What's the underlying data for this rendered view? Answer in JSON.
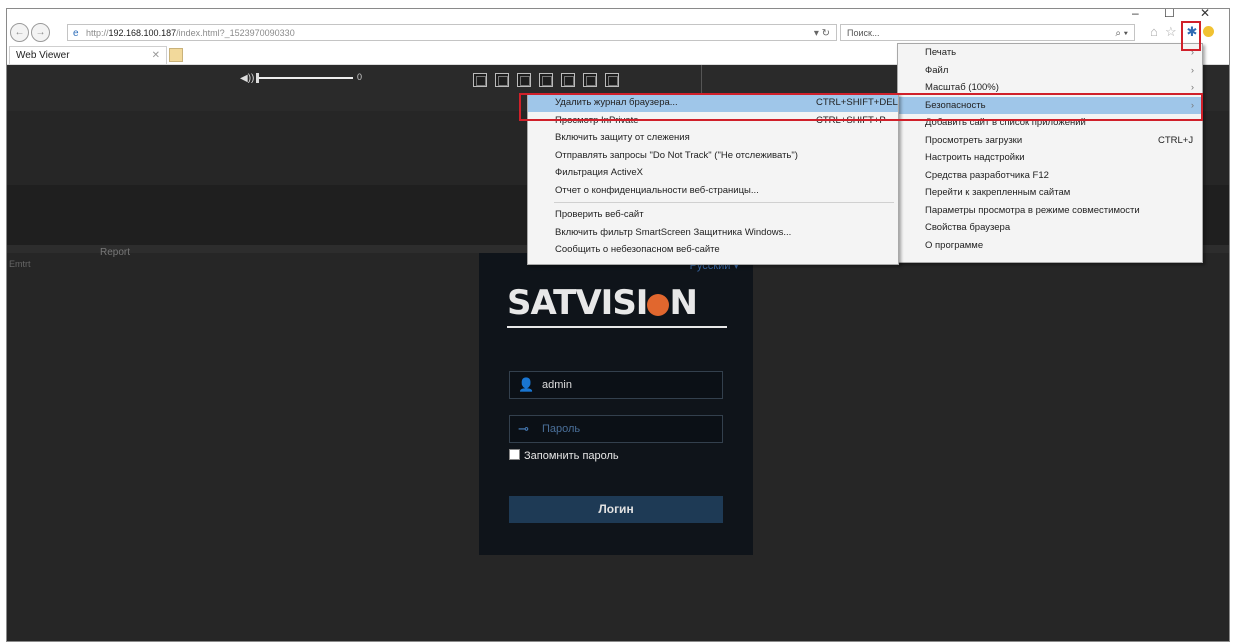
{
  "window": {
    "minimize_label": "–",
    "restore_label": "☐",
    "close_label": "✕"
  },
  "address_bar": {
    "url_prefix": "http://",
    "url_host": "192.168.100.187",
    "url_rest": "/index.html?_1523970090330",
    "refresh_label": "▾ ↻",
    "back_label": "←",
    "forward_label": "→"
  },
  "search": {
    "placeholder": "Поиск...",
    "icon_label": "⌕ ▾"
  },
  "tab": {
    "title": "Web Viewer",
    "close_label": "✕"
  },
  "player": {
    "volume_value": "0",
    "layout_buttons": 7
  },
  "labels": {
    "report": "Report",
    "emtr": "Emtrt"
  },
  "login": {
    "language": "Русский ▾",
    "logo_left": "SAT",
    "logo_mid": "VISI",
    "logo_right": "N",
    "username": "admin",
    "password_placeholder": "Пароль",
    "remember_label": "Запомнить пароль",
    "login_button": "Логин"
  },
  "tools_menu": {
    "items": [
      {
        "label": "Печать",
        "has_arrow": true
      },
      {
        "label": "Файл",
        "has_arrow": true
      },
      {
        "label": "Масштаб (100%)",
        "has_arrow": true
      },
      {
        "label": "Безопасность",
        "has_arrow": true,
        "highlighted": true
      },
      {
        "label": "Добавить сайт в список приложений"
      },
      {
        "label": "Просмотреть загрузки",
        "shortcut": "CTRL+J"
      },
      {
        "label": "Настроить надстройки"
      },
      {
        "label": "Средства разработчика F12"
      },
      {
        "label": "Перейти к закрепленным сайтам"
      },
      {
        "label": "Параметры просмотра в режиме совместимости"
      },
      {
        "label": "Свойства браузера"
      },
      {
        "label": "О программе"
      }
    ]
  },
  "security_menu": {
    "group1": [
      {
        "label": "Удалить журнал браузера...",
        "shortcut": "CTRL+SHIFT+DEL",
        "highlighted": true
      },
      {
        "label": "Просмотр InPrivate",
        "shortcut": "CTRL+SHIFT+P"
      },
      {
        "label": "Включить защиту от слежения"
      },
      {
        "label": "Отправлять запросы \"Do Not Track\" (\"Не отслеживать\")"
      },
      {
        "label": "Фильтрация ActiveX"
      },
      {
        "label": "Отчет о конфиденциальности веб-страницы..."
      }
    ],
    "group2": [
      {
        "label": "Проверить веб-сайт"
      },
      {
        "label": "Включить фильтр SmartScreen Защитника Windows..."
      },
      {
        "label": "Сообщить о небезопасном веб-сайте"
      }
    ]
  },
  "colors": {
    "highlight": "#9fc6e9",
    "annotation_red": "#d0202a",
    "login_button": "#1e3a55",
    "logo_accent": "#e1672e"
  },
  "icons": [
    "back-icon",
    "forward-icon",
    "ie-logo-icon",
    "refresh-icon",
    "search-icon",
    "home-icon",
    "favorites-icon",
    "gear-icon",
    "smiley-icon",
    "volume-icon",
    "user-icon",
    "key-icon"
  ]
}
